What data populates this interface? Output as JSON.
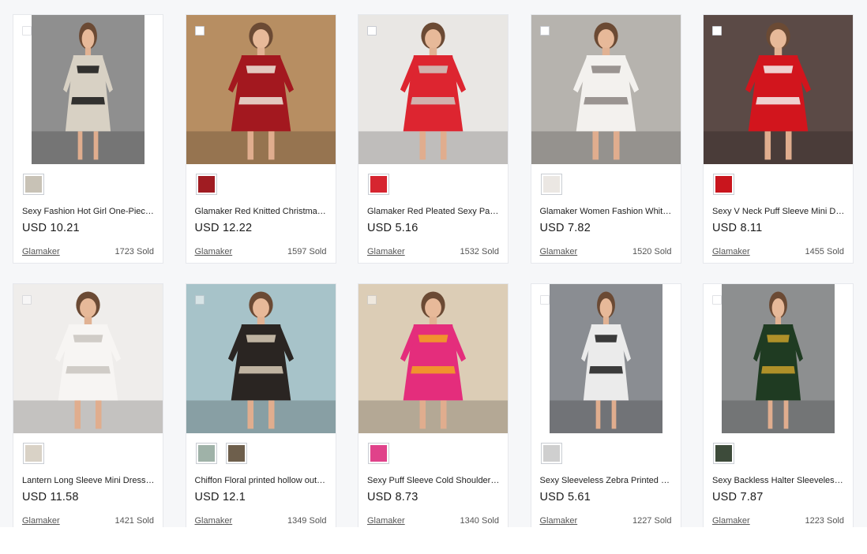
{
  "products": [
    {
      "title": "Sexy Fashion Hot Girl One-Piece Long-Sleeved Shirt Dress",
      "price": "USD 10.21",
      "store": "Glamaker",
      "sold": "1723 Sold",
      "checked": false,
      "photo": "narrow",
      "bg": "#8f8f8f",
      "dress": "#d8d1c4",
      "accent": "#151515",
      "swatches": [
        "#c8c2b6"
      ]
    },
    {
      "title": "Glamaker Red Knitted Christmas Sweater Dress",
      "price": "USD 12.22",
      "store": "Glamaker",
      "sold": "1597 Sold",
      "checked": true,
      "photo": "full",
      "bg": "#b78e62",
      "dress": "#a3181f",
      "accent": "#efe7dc",
      "swatches": [
        "#a01c22"
      ]
    },
    {
      "title": "Glamaker Red Pleated Sexy Party Bodycon Dress",
      "price": "USD 5.16",
      "store": "Glamaker",
      "sold": "1532 Sold",
      "checked": true,
      "photo": "full",
      "bg": "#e9e7e4",
      "dress": "#dd2530",
      "accent": "#cfcac3",
      "swatches": [
        "#d62530"
      ]
    },
    {
      "title": "Glamaker Women Fashion White Lantern Sleeve Shirt Dress",
      "price": "USD 7.82",
      "store": "Glamaker",
      "sold": "1520 Sold",
      "checked": true,
      "photo": "full",
      "bg": "#b6b3ae",
      "dress": "#f3f1ee",
      "accent": "#8a8480",
      "swatches": [
        "#ebe7e3"
      ]
    },
    {
      "title": "Sexy V Neck Puff Sleeve Mini Dress",
      "price": "USD 8.11",
      "store": "Glamaker",
      "sold": "1455 Sold",
      "checked": true,
      "photo": "full",
      "bg": "#5b4a46",
      "dress": "#d2151d",
      "accent": "#f4f1ee",
      "swatches": [
        "#c9151d"
      ]
    },
    {
      "title": "Lantern Long Sleeve Mini Dress with Ruffle Collar",
      "price": "USD 11.58",
      "store": "Glamaker",
      "sold": "1421 Sold",
      "checked": false,
      "photo": "full",
      "bg": "#efedeb",
      "dress": "#f7f5f3",
      "accent": "#c9c4be",
      "swatches": [
        "#d9d2c6"
      ]
    },
    {
      "title": "Chiffon Floral printed hollow out two piece dress",
      "price": "USD 12.1",
      "store": "Glamaker",
      "sold": "1349 Sold",
      "checked": false,
      "photo": "full",
      "bg": "#a7c3c9",
      "dress": "#2a2522",
      "accent": "#d9cdb7",
      "swatches": [
        "#9fb2a8",
        "#6e5f4c"
      ]
    },
    {
      "title": "Sexy Puff Sleeve Cold Shoulder Printed Mini Dress",
      "price": "USD 8.73",
      "store": "Glamaker",
      "sold": "1340 Sold",
      "checked": false,
      "photo": "full",
      "bg": "#dccdb6",
      "dress": "#e42d7c",
      "accent": "#f3a521",
      "swatches": [
        "#e0428a"
      ]
    },
    {
      "title": "Sexy Sleeveless Zebra Printed Party Mini Dress",
      "price": "USD 5.61",
      "store": "Glamaker",
      "sold": "1227 Sold",
      "checked": false,
      "photo": "narrow",
      "bg": "#8a8d92",
      "dress": "#ebebeb",
      "accent": "#1c1c1c",
      "swatches": [
        "#cfcfcf"
      ]
    },
    {
      "title": "Sexy Backless Halter Sleeveless Split Maxi Dress",
      "price": "USD 7.87",
      "store": "Glamaker",
      "sold": "1223 Sold",
      "checked": false,
      "photo": "narrow",
      "bg": "#8d8f90",
      "dress": "#1f3b22",
      "accent": "#c9a02a",
      "swatches": [
        "#3d4b3a"
      ]
    }
  ]
}
